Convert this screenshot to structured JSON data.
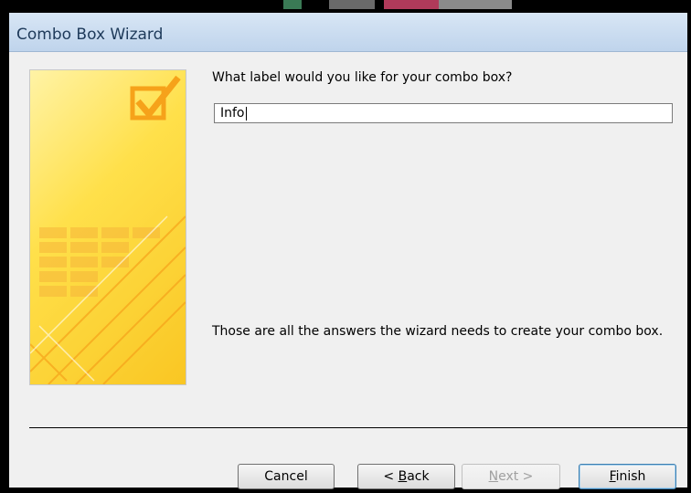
{
  "window": {
    "title": "Combo Box Wizard"
  },
  "wizard": {
    "prompt": "What label would you like for your combo box?",
    "label_value": "Info",
    "info_text": "Those are all the answers the wizard needs to create your combo box."
  },
  "buttons": {
    "cancel": "Cancel",
    "back_prefix": "< ",
    "back_key": "B",
    "back_rest": "ack",
    "next_key": "N",
    "next_rest": "ext >",
    "finish_key": "F",
    "finish_rest": "inish"
  },
  "colors": {
    "accent": "#3c7fb1",
    "title_bar": "#bfd4ec",
    "art_yellow": "#ffe04a",
    "art_orange": "#f6a21a"
  },
  "icons": {
    "wizard_art": "checkmark-art-icon"
  }
}
